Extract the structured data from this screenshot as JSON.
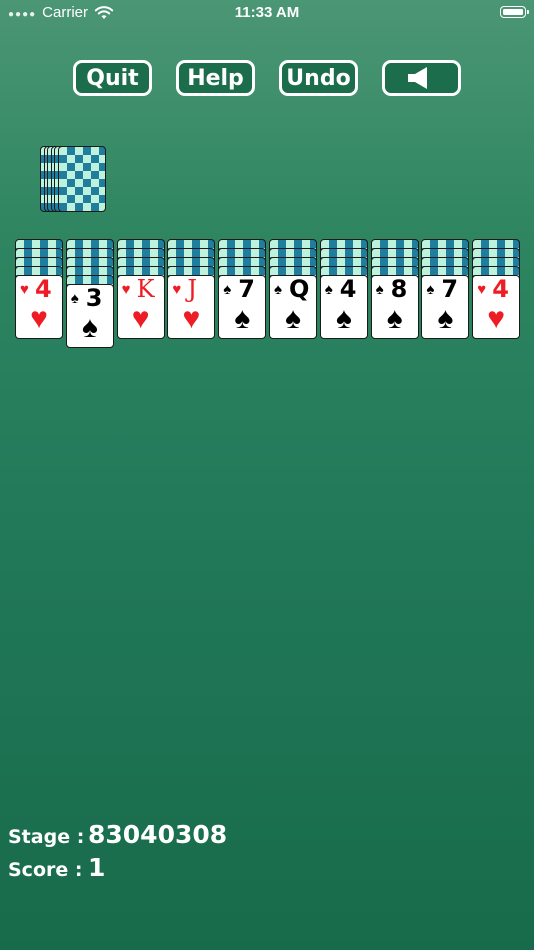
{
  "status_bar": {
    "carrier": "Carrier",
    "time": "11:33 AM"
  },
  "toolbar": {
    "quit_label": "Quit",
    "help_label": "Help",
    "undo_label": "Undo",
    "sound_icon": "speaker-icon"
  },
  "stock": {
    "card_count_visible": 6
  },
  "tableau": {
    "columns": [
      {
        "face_down": 4,
        "rank": "4",
        "suit": "♥",
        "color": "red"
      },
      {
        "face_down": 5,
        "rank": "3",
        "suit": "♠",
        "color": "black"
      },
      {
        "face_down": 4,
        "rank": "K",
        "suit": "♥",
        "color": "red"
      },
      {
        "face_down": 4,
        "rank": "J",
        "suit": "♥",
        "color": "red"
      },
      {
        "face_down": 4,
        "rank": "7",
        "suit": "♠",
        "color": "black"
      },
      {
        "face_down": 4,
        "rank": "Q",
        "suit": "♠",
        "color": "black"
      },
      {
        "face_down": 4,
        "rank": "4",
        "suit": "♠",
        "color": "black"
      },
      {
        "face_down": 4,
        "rank": "8",
        "suit": "♠",
        "color": "black"
      },
      {
        "face_down": 4,
        "rank": "7",
        "suit": "♠",
        "color": "black"
      },
      {
        "face_down": 4,
        "rank": "4",
        "suit": "♥",
        "color": "red"
      }
    ]
  },
  "info": {
    "stage_label": "Stage :",
    "stage_value": "83040308",
    "score_label": "Score :",
    "score_value": "1"
  },
  "colors": {
    "felt_top": "#4b9675",
    "felt_bottom": "#186b4a",
    "card_back_light": "#bff2dc",
    "card_back_dark": "#1f7e9e",
    "red_suit": "#ee1c24"
  }
}
